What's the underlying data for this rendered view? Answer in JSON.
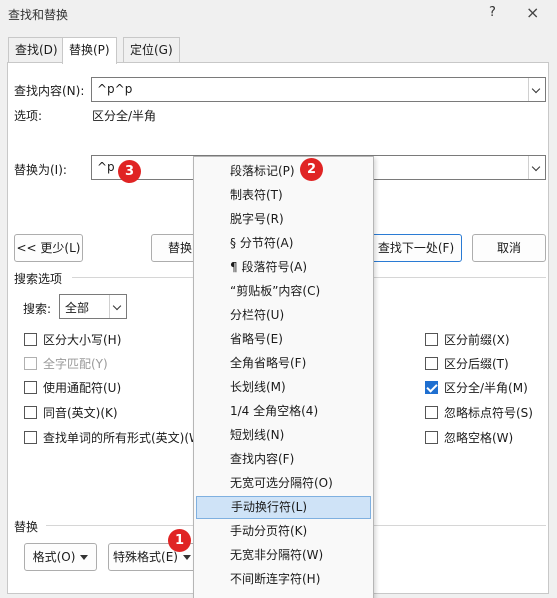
{
  "window": {
    "title": "查找和替换",
    "help": "?",
    "close": "×"
  },
  "tabs": [
    {
      "label": "查找(D)"
    },
    {
      "label": "替换(P)"
    },
    {
      "label": "定位(G)"
    }
  ],
  "find": {
    "label": "查找内容(N):",
    "value": "^p^p"
  },
  "options": {
    "label": "选项:",
    "value": "区分全/半角"
  },
  "replace": {
    "label": "替换为(I):",
    "value": "^p"
  },
  "buttons": {
    "less": "<< 更少(L)",
    "replace": "替换",
    "find_next": "查找下一处(F)",
    "cancel": "取消"
  },
  "search_options": {
    "title": "搜索选项",
    "search_label": "搜索:",
    "search_value": "全部"
  },
  "checks_left": [
    {
      "label": "区分大小写(H)",
      "checked": false,
      "disabled": false
    },
    {
      "label": "全字匹配(Y)",
      "checked": false,
      "disabled": true
    },
    {
      "label": "使用通配符(U)",
      "checked": false,
      "disabled": false
    },
    {
      "label": "同音(英文)(K)",
      "checked": false,
      "disabled": false
    },
    {
      "label": "查找单词的所有形式(英文)(W)",
      "checked": false,
      "disabled": false
    }
  ],
  "checks_right": [
    {
      "label": "区分前缀(X)",
      "checked": false
    },
    {
      "label": "区分后缀(T)",
      "checked": false
    },
    {
      "label": "区分全/半角(M)",
      "checked": true
    },
    {
      "label": "忽略标点符号(S)",
      "checked": false
    },
    {
      "label": "忽略空格(W)",
      "checked": false
    }
  ],
  "replace_section": {
    "title": "替换",
    "format_button": "格式(O)",
    "special_button": "特殊格式(E)"
  },
  "special_menu": {
    "items": [
      "段落标记(P)",
      "制表符(T)",
      "脱字号(R)",
      "§ 分节符(A)",
      "¶ 段落符号(A)",
      "“剪贴板”内容(C)",
      "分栏符(U)",
      "省略号(E)",
      "全角省略号(F)",
      "长划线(M)",
      "1/4 全角空格(4)",
      "短划线(N)",
      "查找内容(F)",
      "无宽可选分隔符(O)",
      "手动换行符(L)",
      "手动分页符(K)",
      "无宽非分隔符(W)",
      "不间断连字符(H)"
    ],
    "highlighted_index": 14
  },
  "badges": {
    "b1": "1",
    "b2": "2",
    "b3": "3"
  },
  "colors": {
    "accent": "#1f6fd0",
    "badge": "#e02424",
    "highlight": "#cfe3f7"
  }
}
